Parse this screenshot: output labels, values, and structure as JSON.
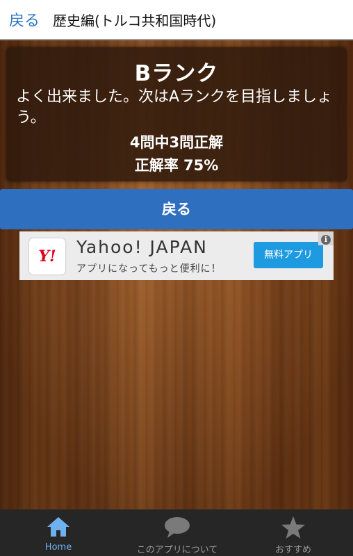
{
  "header": {
    "back_label": "戻る",
    "title": "歴史編(トルコ共和国時代)"
  },
  "result": {
    "rank": "Bランク",
    "message": "よく出来ました。次はAランクを目指しましょう。",
    "score": "4問中3問正解",
    "rate": "正解率 75%"
  },
  "actions": {
    "back_button": "戻る"
  },
  "ad": {
    "logo_text": "Y!",
    "title": "Yahoo! JAPAN",
    "subtitle": "アプリになってもっと便利に！",
    "cta": "無料アプリ",
    "info_icon": "i",
    "colors": {
      "cta": "#1e9be0",
      "logo": "#e0001e"
    }
  },
  "bottom_nav": {
    "items": [
      {
        "label": "Home",
        "icon": "home-icon",
        "active": true
      },
      {
        "label": "このアプリについて",
        "icon": "chat-bubble-icon",
        "active": false
      },
      {
        "label": "おすすめ",
        "icon": "star-icon",
        "active": false
      }
    ]
  },
  "colors": {
    "accent": "#2e78c8",
    "button": "#2f6fc0",
    "nav_active": "#6fb0ee"
  }
}
